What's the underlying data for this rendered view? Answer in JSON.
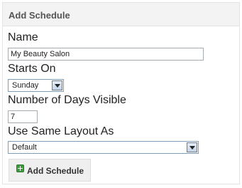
{
  "panel": {
    "title": "Add Schedule"
  },
  "form": {
    "name_label": "Name",
    "name_value": "My Beauty Salon",
    "starts_on_label": "Starts On",
    "starts_on_value": "Sunday",
    "days_visible_label": "Number of Days Visible",
    "days_visible_value": "7",
    "layout_label": "Use Same Layout As",
    "layout_value": "Default"
  },
  "buttons": {
    "add_schedule_label": "Add Schedule",
    "add_icon": "plus-icon"
  },
  "colors": {
    "header_bg": "#f3f3f3",
    "button_bg": "#efefef",
    "plus_icon": "#3d9b3d"
  }
}
